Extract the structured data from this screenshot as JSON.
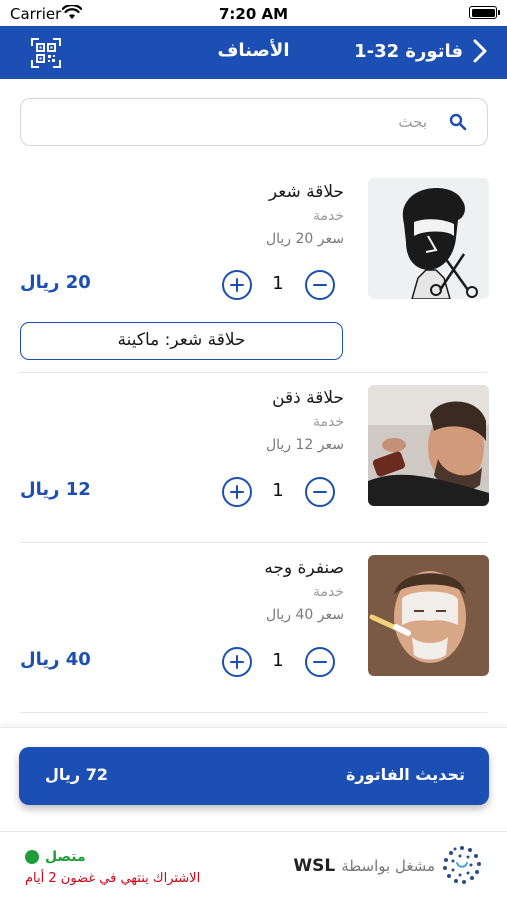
{
  "status_bar": {
    "carrier": "Carrier",
    "time": "7:20 AM"
  },
  "nav": {
    "title": "الأصناف",
    "back_label": "فاتورة 32-1",
    "qr_icon": "qr-scan-icon",
    "back_icon": "chevron-right-icon"
  },
  "search": {
    "placeholder": "بحث",
    "value": "",
    "icon": "search-icon"
  },
  "items": [
    {
      "name": "حلاقة شعر",
      "type": "خدمة",
      "unit_price": "سعر 20 ريال",
      "quantity": "1",
      "total": "20 ريال",
      "note": "حلاقة شعر: ماكينة",
      "image": "haircut-photo"
    },
    {
      "name": "حلاقة ذقن",
      "type": "خدمة",
      "unit_price": "سعر 12 ريال",
      "quantity": "1",
      "total": "12 ريال",
      "image": "beard-trim-photo"
    },
    {
      "name": "صنفرة وجه",
      "type": "خدمة",
      "unit_price": "سعر 40 ريال",
      "quantity": "1",
      "total": "40 ريال",
      "image": "face-mask-photo"
    }
  ],
  "footer": {
    "update_label": "تحديث الفاتورة",
    "update_total": "72 ريال",
    "status": "متصل",
    "subscription": "الاشتراك ينتهي في غضون 2 أيام",
    "powered_by": "مشغل بواسطة",
    "brand": "WSL"
  },
  "colors": {
    "primary": "#1b4fb3",
    "online": "#1f9d38",
    "warning": "#d0021b"
  }
}
